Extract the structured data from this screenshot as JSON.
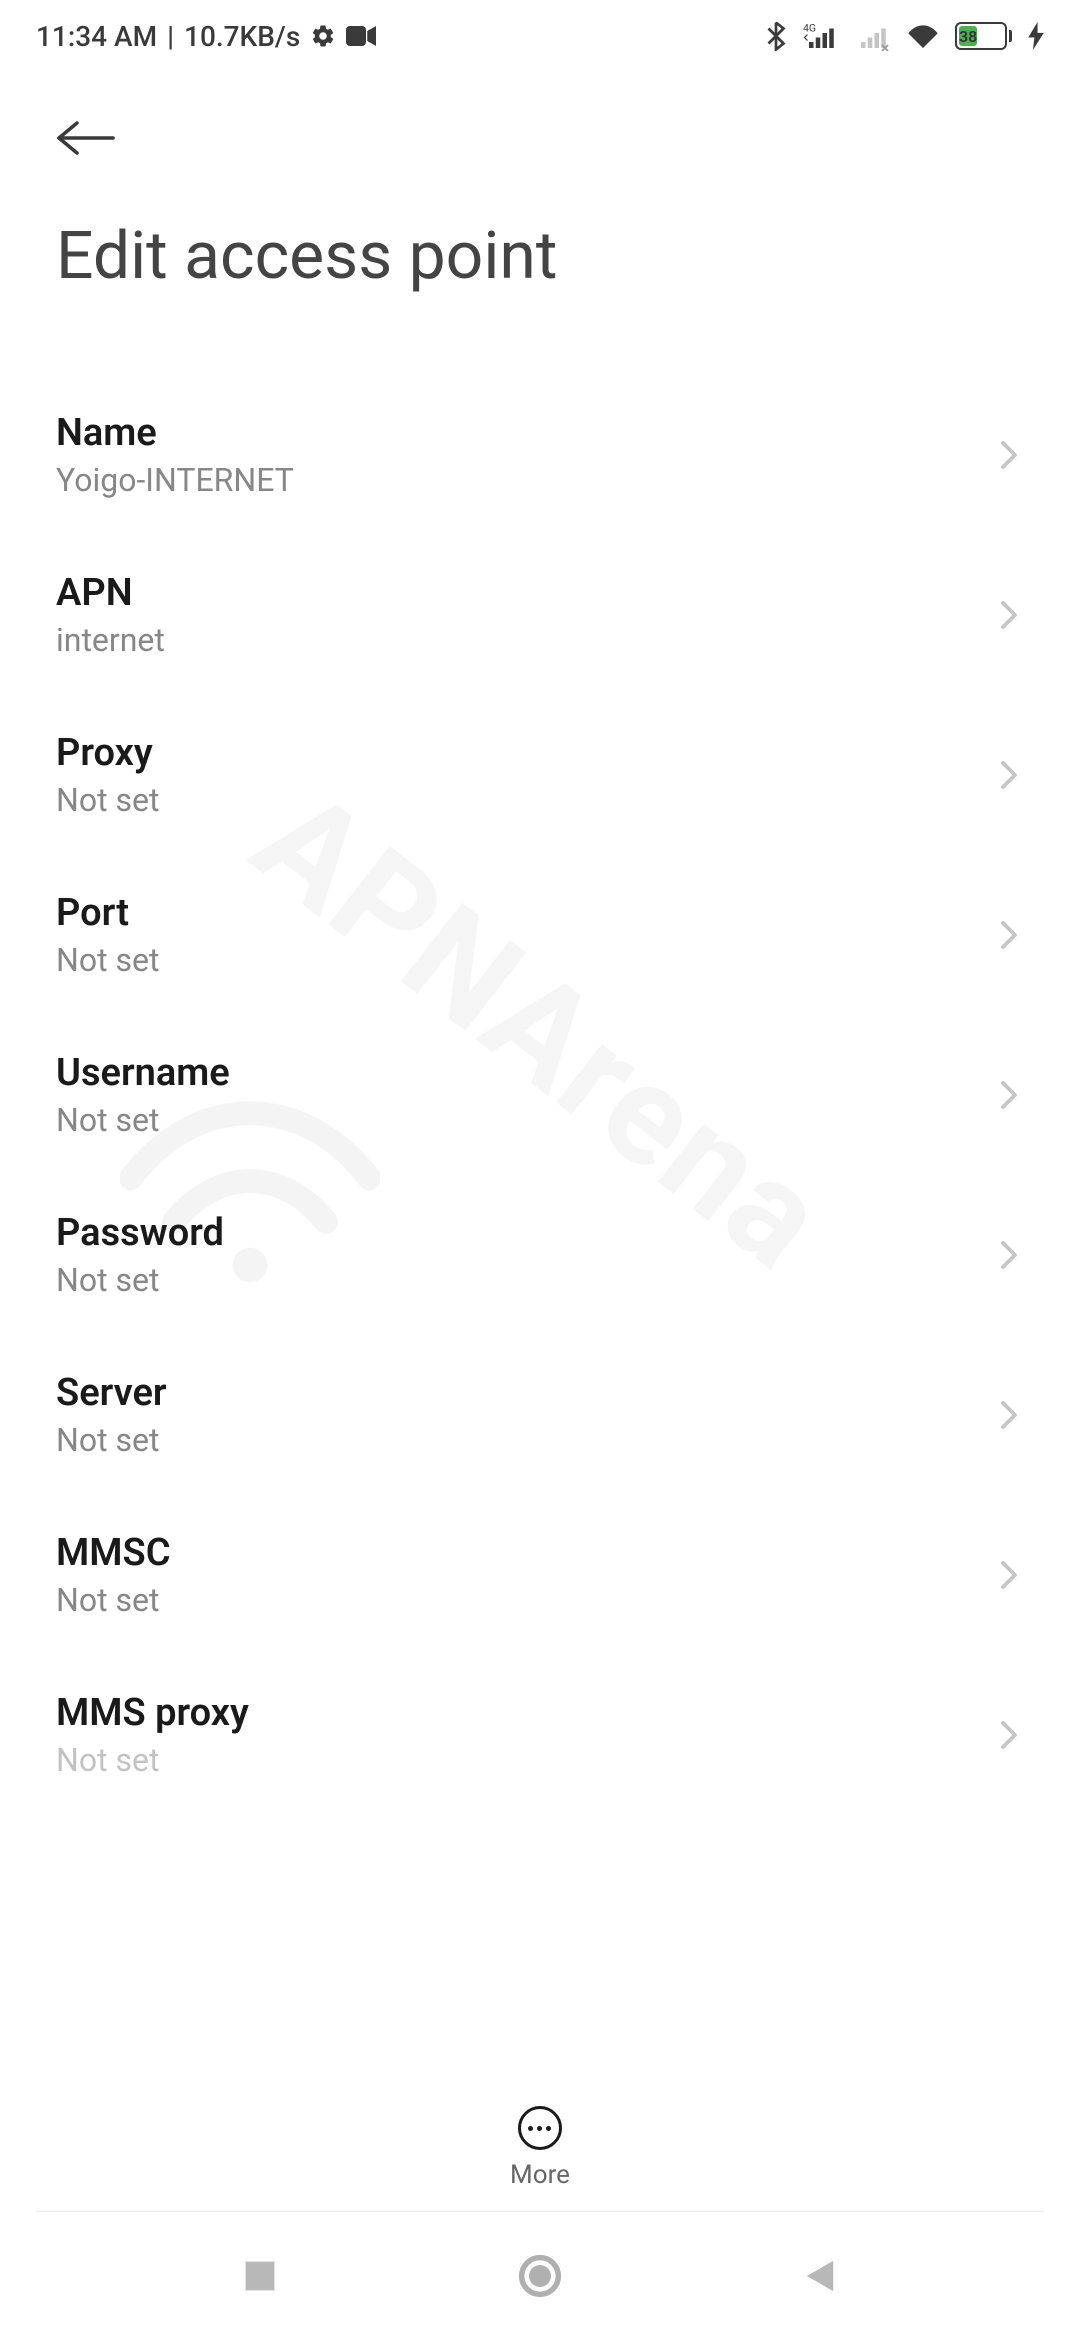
{
  "status": {
    "time": "11:34 AM",
    "net_speed": "10.7KB/s",
    "battery_pct": "38"
  },
  "header": {
    "title": "Edit access point"
  },
  "settings": {
    "name": {
      "label": "Name",
      "value": "Yoigo-INTERNET"
    },
    "apn": {
      "label": "APN",
      "value": "internet"
    },
    "proxy": {
      "label": "Proxy",
      "value": "Not set"
    },
    "port": {
      "label": "Port",
      "value": "Not set"
    },
    "username": {
      "label": "Username",
      "value": "Not set"
    },
    "password": {
      "label": "Password",
      "value": "Not set"
    },
    "server": {
      "label": "Server",
      "value": "Not set"
    },
    "mmsc": {
      "label": "MMSC",
      "value": "Not set"
    },
    "mms_proxy": {
      "label": "MMS proxy",
      "value": "Not set"
    }
  },
  "footer": {
    "more_label": "More"
  },
  "watermark": "APNArena"
}
